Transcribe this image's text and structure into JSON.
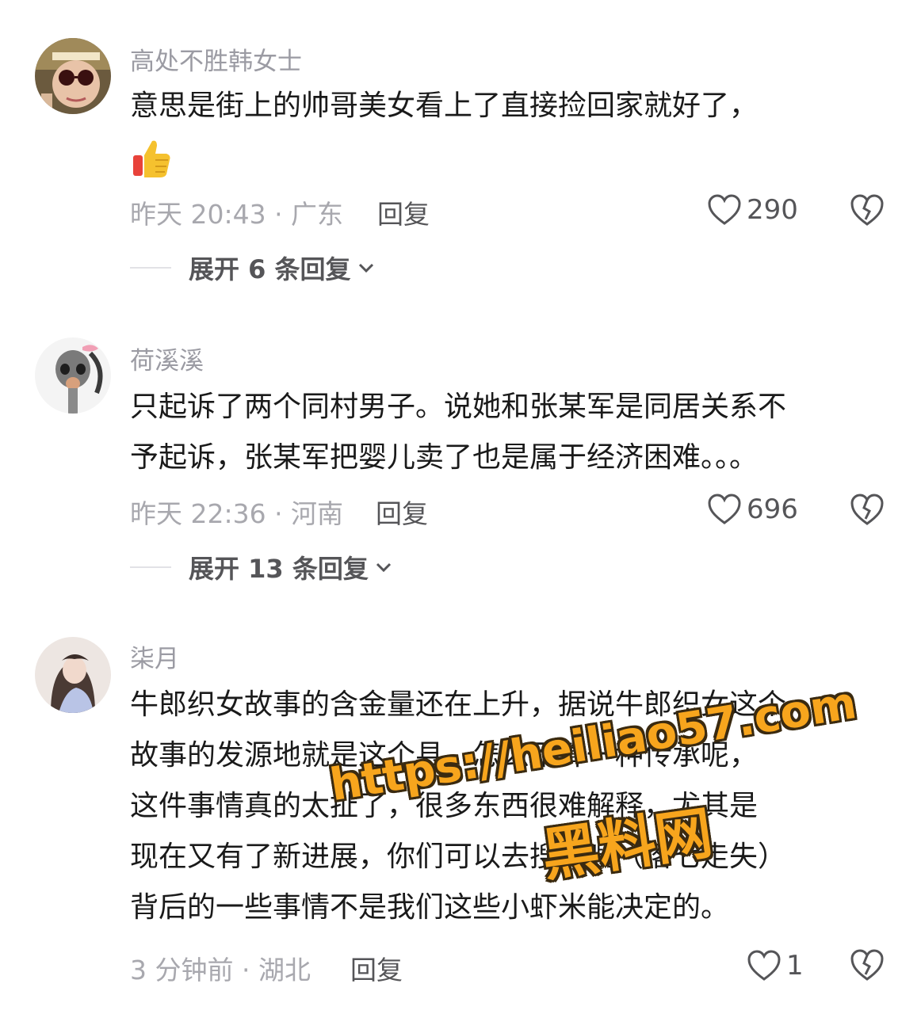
{
  "comments": [
    {
      "username": "高处不胜韩女士",
      "lines": [
        "意思是街上的帅哥美女看上了直接捡回家就好了，"
      ],
      "emoji": "thumbs-up",
      "time_location": "昨天 20:43 · 广东",
      "reply_label": "回复",
      "likes": "290",
      "expand_label": "展开 6 条回复"
    },
    {
      "username": "荷溪溪",
      "lines": [
        "只起诉了两个同村男子。说她和张某军是同居关系不",
        "予起诉，张某军把婴儿卖了也是属于经济困难。。。"
      ],
      "time_location": "昨天 22:36 · 河南",
      "reply_label": "回复",
      "likes": "696",
      "expand_label": "展开 13 条回复"
    },
    {
      "username": "柒月",
      "lines": [
        "牛郎织女故事的含金量还在上升，据说牛郎织女这个",
        "故事的发源地就是这个县，怎么不算一种传承呢，",
        "这件事情真的太扯了，很多东西很难解释，尤其是",
        "现在又有了新进展，你们可以去搜糊嗖（落七走失）",
        "背后的一些事情不是我们这些小虾米能决定的。"
      ],
      "time_location": "3 分钟前 · 湖北",
      "reply_label": "回复",
      "likes": "1"
    }
  ],
  "watermark": {
    "url": "https://heiliao57.com",
    "name": "黑料网"
  },
  "colors": {
    "text": "#1a1a1a",
    "meta": "#a8a8ae",
    "watermark": "#f7a51d"
  }
}
